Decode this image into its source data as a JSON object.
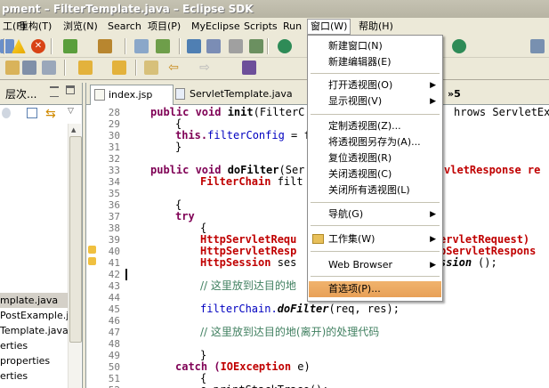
{
  "window": {
    "title": "pment – FilterTemplate.java – Eclipse SDK"
  },
  "menubar": [
    {
      "label": "工(F)"
    },
    {
      "label": "重构(T)"
    },
    {
      "label": "浏览(N)"
    },
    {
      "label": "Search"
    },
    {
      "label": "项目(P)"
    },
    {
      "label": "MyEclipse"
    },
    {
      "label": "Scripts"
    },
    {
      "label": "Run"
    },
    {
      "label": "窗口(W)"
    },
    {
      "label": "帮助(H)"
    }
  ],
  "window_menu": {
    "items": [
      {
        "label": "新建窗口(N)"
      },
      {
        "label": "新建编辑器(E)"
      },
      {
        "label": "打开透视图(O)"
      },
      {
        "label": "显示视图(V)"
      },
      {
        "label": "定制透视图(Z)..."
      },
      {
        "label": "将透视图另存为(A)..."
      },
      {
        "label": "复位透视图(R)"
      },
      {
        "label": "关闭透视图(C)"
      },
      {
        "label": "关闭所有透视图(L)"
      },
      {
        "label": "导航(G)"
      },
      {
        "label": "工作集(W)"
      },
      {
        "label": "Web Browser"
      },
      {
        "label": "首选项(P)..."
      }
    ]
  },
  "left_view": {
    "tab_label": "层次...",
    "tree": [
      {
        "label": "mplate.java"
      },
      {
        "label": "PostExample.ja"
      },
      {
        "label": "Template.java"
      },
      {
        "label": "erties"
      },
      {
        "label": "properties"
      },
      {
        "label": "erties"
      }
    ]
  },
  "editor": {
    "tabs": [
      {
        "label": "index.jsp"
      },
      {
        "label": "ServletTemplate.java"
      },
      {
        "label": "»5"
      }
    ],
    "line_numbers": [
      "28",
      "29",
      "30",
      "31",
      "32",
      "33",
      "34",
      "35",
      "36",
      "37",
      "38",
      "39",
      "40",
      "41",
      "42",
      "43",
      "44",
      "45",
      "46",
      "47",
      "48",
      "49",
      "50",
      "51",
      "52"
    ],
    "code": {
      "l28a": "public void ",
      "l28b": "init",
      "l28c": "(FilterC",
      "l28d": "hrows ServletExce",
      "l29": "{",
      "l30a": "this.",
      "l30b": "filterConfig",
      "l30c": " = f",
      "l31": "}",
      "l33a": "public void ",
      "l33b": "doFilter",
      "l33c": "(Ser",
      "l33d": "vletResponse re",
      "l34a": "FilterChain",
      "l34b": " filt",
      "l36": "{",
      "l37": "try",
      "l38": "{",
      "l39a": "HttpServletRequ",
      "l39b": "ervletRequest)",
      "l40a": "HttpServletResp",
      "l40b": "pServletRespons",
      "l41a": "HttpSession",
      "l41b": " ses",
      "l41c": "ssion",
      "l41d": "();",
      "l43": "// 这里放到达目的地",
      "l45a": "filterChain.",
      "l45b": "doFilter",
      "l45c": "(req, res);",
      "l47": "// 这里放到达目的地(离开)的处理代码",
      "l49": "}",
      "l50a": "catch (",
      "l50b": "IOException",
      "l50c": " e)",
      "l51": "{",
      "l52": "e.printStackTrace();"
    }
  }
}
